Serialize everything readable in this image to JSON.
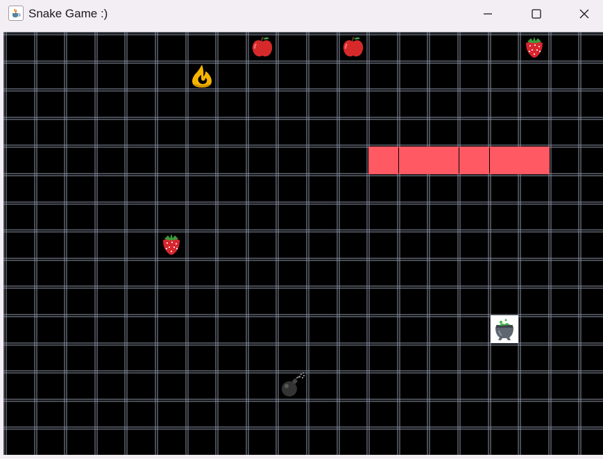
{
  "window": {
    "title": "Snake Game :)",
    "icon": "java-cup-icon",
    "controls": [
      "minimize-icon",
      "maximize-icon",
      "close-icon"
    ]
  },
  "colors": {
    "board_background": "#000000",
    "grid_line": "#8e96a8",
    "snake_body": "#ff5a64",
    "titlebar_background": "#f3eef4"
  },
  "board": {
    "columns": 20,
    "rows": 15,
    "snake": [
      [
        12,
        4
      ],
      [
        13,
        4
      ],
      [
        14,
        4
      ],
      [
        15,
        4
      ],
      [
        16,
        4
      ],
      [
        17,
        4
      ]
    ],
    "items": [
      {
        "type": "apple",
        "icon": "apple-icon",
        "col": 8,
        "row": 0
      },
      {
        "type": "apple",
        "icon": "apple-icon",
        "col": 11,
        "row": 0
      },
      {
        "type": "strawberry",
        "icon": "strawberry-icon",
        "col": 17,
        "row": 0
      },
      {
        "type": "fire",
        "icon": "fire-icon",
        "col": 6,
        "row": 1
      },
      {
        "type": "strawberry",
        "icon": "strawberry-icon",
        "col": 5,
        "row": 7
      },
      {
        "type": "cauldron",
        "icon": "cauldron-icon",
        "col": 16,
        "row": 10
      },
      {
        "type": "bomb",
        "icon": "bomb-icon",
        "col": 9,
        "row": 12
      }
    ]
  }
}
